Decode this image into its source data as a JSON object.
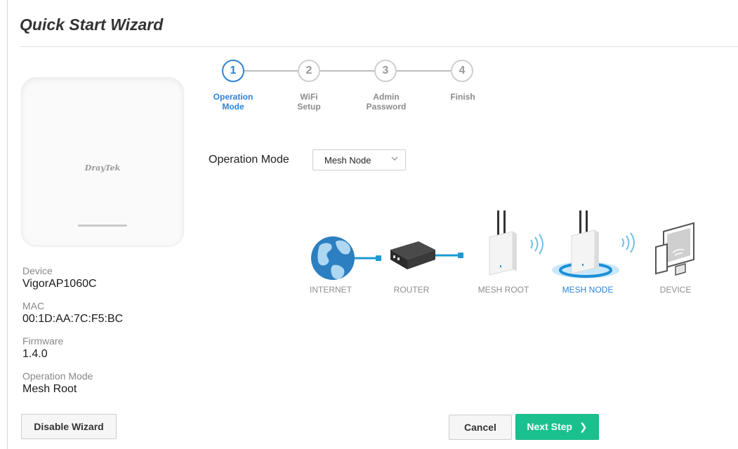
{
  "page": {
    "title": "Quick Start Wizard"
  },
  "device_card": {
    "brand_logo": "DrayTek",
    "fields": [
      {
        "label": "Device",
        "value": "VigorAP1060C"
      },
      {
        "label": "MAC",
        "value": "00:1D:AA:7C:F5:BC"
      },
      {
        "label": "Firmware",
        "value": "1.4.0"
      },
      {
        "label": "Operation Mode",
        "value": "Mesh Root"
      }
    ]
  },
  "stepper": {
    "active_step": 1,
    "steps": [
      {
        "number": "1",
        "line1": "Operation",
        "line2": "Mode"
      },
      {
        "number": "2",
        "line1": "WiFi",
        "line2": "Setup"
      },
      {
        "number": "3",
        "line1": "Admin",
        "line2": "Password"
      },
      {
        "number": "4",
        "line1": "Finish",
        "line2": ""
      }
    ]
  },
  "operation_mode": {
    "label": "Operation Mode",
    "selected": "Mesh Node"
  },
  "topology": {
    "nodes": [
      "INTERNET",
      "ROUTER",
      "MESH ROOT",
      "MESH NODE",
      "DEVICE"
    ],
    "highlighted": "MESH NODE"
  },
  "buttons": {
    "disable_wizard": "Disable Wizard",
    "cancel": "Cancel",
    "next_step": "Next Step"
  },
  "colors": {
    "accent": "#2f83d3",
    "primary_button": "#1bc08f",
    "cable": "#1b9ad6"
  }
}
